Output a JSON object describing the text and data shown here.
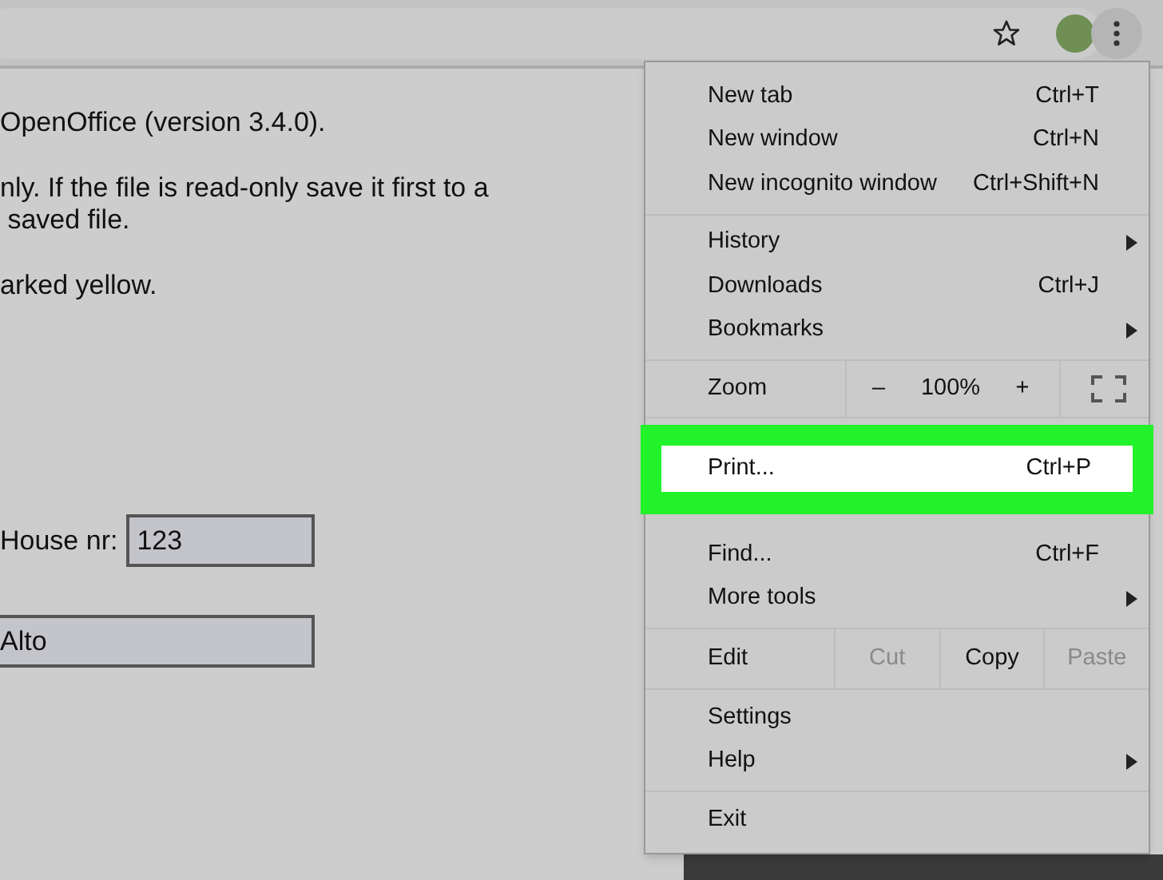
{
  "page": {
    "paragraphs": [
      [
        "OpenOffice (version 3.4.0)."
      ],
      [
        "nly. If the file is read-only save it first to a",
        " saved file."
      ],
      [
        "arked yellow."
      ]
    ],
    "house_label": "House nr:",
    "house_value": "123",
    "city_value": "Alto"
  },
  "menu": {
    "groups": [
      {
        "kind": "items",
        "items": [
          {
            "label": "New tab",
            "shortcut": "Ctrl+T",
            "submenu": false,
            "highlighted": false
          },
          {
            "label": "New window",
            "shortcut": "Ctrl+N",
            "submenu": false,
            "highlighted": false
          },
          {
            "label": "New incognito window",
            "shortcut": "Ctrl+Shift+N",
            "submenu": false,
            "highlighted": false
          }
        ]
      },
      {
        "kind": "items",
        "items": [
          {
            "label": "History",
            "submenu": true,
            "highlighted": false
          },
          {
            "label": "Downloads",
            "shortcut": "Ctrl+J",
            "submenu": false,
            "highlighted": false
          },
          {
            "label": "Bookmarks",
            "submenu": true,
            "highlighted": false
          }
        ]
      },
      {
        "kind": "zoom",
        "label": "Zoom",
        "minus": "–",
        "value": "100%",
        "plus": "+"
      },
      {
        "kind": "items",
        "items": [
          {
            "label": "Print...",
            "shortcut": "Ctrl+P",
            "submenu": false,
            "highlighted": true
          },
          {
            "label": "Find...",
            "shortcut": "Ctrl+F",
            "submenu": false,
            "highlighted": false
          },
          {
            "label": "More tools",
            "submenu": true,
            "highlighted": false
          }
        ]
      },
      {
        "kind": "edit",
        "label": "Edit",
        "buttons": [
          {
            "label": "Cut",
            "disabled": true
          },
          {
            "label": "Copy",
            "disabled": false
          },
          {
            "label": "Paste",
            "disabled": true
          }
        ]
      },
      {
        "kind": "items",
        "items": [
          {
            "label": "Settings",
            "submenu": false,
            "highlighted": false
          },
          {
            "label": "Help",
            "submenu": true,
            "highlighted": false
          }
        ]
      },
      {
        "kind": "items",
        "items": [
          {
            "label": "Exit",
            "submenu": false,
            "highlighted": false
          }
        ]
      }
    ]
  }
}
